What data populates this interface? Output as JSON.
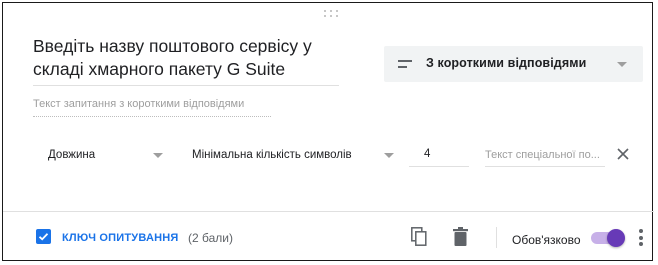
{
  "question": {
    "title": "Введіть назву поштового сервісу у складі хмарного пакету G Suite",
    "type_label": "З короткими відповідями",
    "answer_placeholder": "Текст запитання з короткими відповідями"
  },
  "validation": {
    "type": "Довжина",
    "operator": "Мінімальна кількість символів",
    "value": "4",
    "error_placeholder": "Текст спеціальної по..."
  },
  "footer": {
    "answer_key_label": "КЛЮЧ ОПИТУВАННЯ",
    "points": "(2 бали)",
    "required_label": "Обов'язково",
    "required_on": true
  },
  "colors": {
    "accent_blue": "#1a73e8",
    "toggle_purple": "#673ab7",
    "toggle_track": "#c7b0e8"
  },
  "icons": {
    "drag": "drag-handle-icon",
    "type": "short-text-icon",
    "close": "close-icon",
    "copy": "copy-icon",
    "delete": "trash-icon",
    "more": "more-vert-icon"
  }
}
